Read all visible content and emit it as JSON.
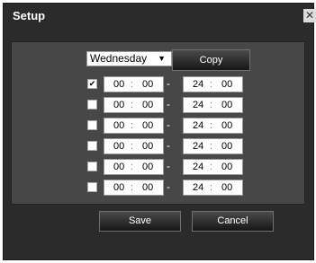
{
  "dialog": {
    "title": "Setup",
    "close_glyph": "✕"
  },
  "day_select": {
    "value": "Wednesday",
    "arrow": "▼"
  },
  "buttons": {
    "copy": "Copy",
    "save": "Save",
    "cancel": "Cancel"
  },
  "separator": "-",
  "time_colon": ":",
  "rows": [
    {
      "checked": "✔",
      "start_h": "00",
      "start_m": "00",
      "end_h": "24",
      "end_m": "00"
    },
    {
      "checked": "",
      "start_h": "00",
      "start_m": "00",
      "end_h": "24",
      "end_m": "00"
    },
    {
      "checked": "",
      "start_h": "00",
      "start_m": "00",
      "end_h": "24",
      "end_m": "00"
    },
    {
      "checked": "",
      "start_h": "00",
      "start_m": "00",
      "end_h": "24",
      "end_m": "00"
    },
    {
      "checked": "",
      "start_h": "00",
      "start_m": "00",
      "end_h": "24",
      "end_m": "00"
    },
    {
      "checked": "",
      "start_h": "00",
      "start_m": "00",
      "end_h": "24",
      "end_m": "00"
    }
  ]
}
